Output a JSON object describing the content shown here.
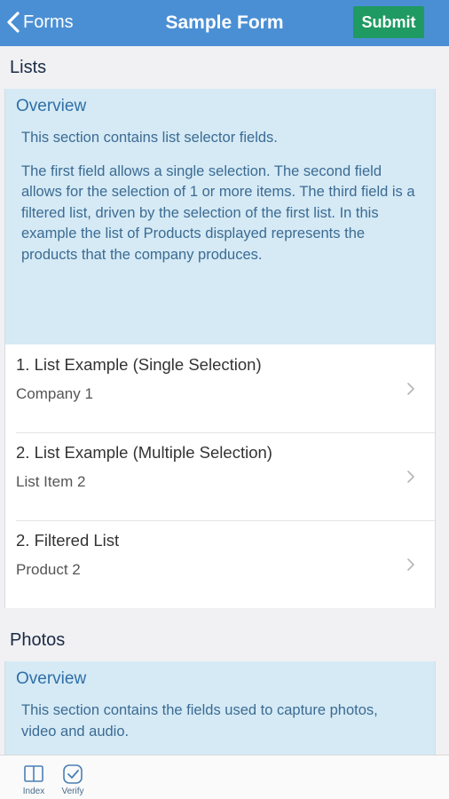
{
  "navbar": {
    "back_label": "Forms",
    "title": "Sample Form",
    "submit_label": "Submit"
  },
  "sections": [
    {
      "title": "Lists",
      "overview": {
        "title": "Overview",
        "paragraphs": [
          "This section contains list selector fields.",
          "The first field allows a single selection.  The second field allows for the selection of 1 or more items.  The third field is a filtered list, driven by the selection of the first list.  In this example the list of Products displayed represents the products that the company produces."
        ]
      },
      "items": [
        {
          "label": "1. List Example (Single Selection)",
          "value": "Company 1"
        },
        {
          "label": "2. List Example (Multiple Selection)",
          "value": "List Item 2"
        },
        {
          "label": "2. Filtered List",
          "value": "Product 2"
        }
      ]
    },
    {
      "title": "Photos",
      "overview": {
        "title": "Overview",
        "paragraphs": [
          "This section contains the fields used to capture photos, video and audio."
        ]
      }
    }
  ],
  "toolbar": {
    "index_label": "Index",
    "verify_label": "Verify"
  },
  "colors": {
    "navbar": "#4a8fd4",
    "submit": "#1f9a62",
    "overview_bg": "#d5eaf5",
    "overview_title": "#2f6fa6"
  }
}
